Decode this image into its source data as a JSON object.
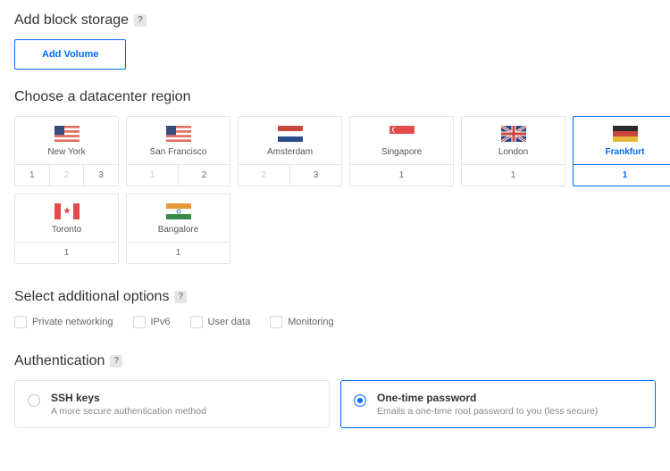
{
  "block_storage": {
    "heading": "Add block storage",
    "add_button": "Add Volume"
  },
  "datacenter": {
    "heading": "Choose a datacenter region",
    "regions": [
      {
        "name": "New York",
        "nums": [
          {
            "n": "1",
            "d": false
          },
          {
            "n": "2",
            "d": true
          },
          {
            "n": "3",
            "d": false
          }
        ]
      },
      {
        "name": "San Francisco",
        "nums": [
          {
            "n": "1",
            "d": true
          },
          {
            "n": "2",
            "d": false
          }
        ]
      },
      {
        "name": "Amsterdam",
        "nums": [
          {
            "n": "2",
            "d": true
          },
          {
            "n": "3",
            "d": false
          }
        ]
      },
      {
        "name": "Singapore",
        "nums": [
          {
            "n": "1",
            "d": false
          }
        ]
      },
      {
        "name": "London",
        "nums": [
          {
            "n": "1",
            "d": false
          }
        ]
      },
      {
        "name": "Frankfurt",
        "nums": [
          {
            "n": "1",
            "d": false,
            "active": true
          }
        ],
        "selected": true
      },
      {
        "name": "Toronto",
        "nums": [
          {
            "n": "1",
            "d": false
          }
        ]
      },
      {
        "name": "Bangalore",
        "nums": [
          {
            "n": "1",
            "d": false
          }
        ]
      }
    ]
  },
  "additional": {
    "heading": "Select additional options",
    "options": [
      {
        "label": "Private networking"
      },
      {
        "label": "IPv6"
      },
      {
        "label": "User data"
      },
      {
        "label": "Monitoring"
      }
    ]
  },
  "auth": {
    "heading": "Authentication",
    "ssh": {
      "title": "SSH keys",
      "desc": "A more secure authentication method"
    },
    "otp": {
      "title": "One-time password",
      "desc": "Emails a one-time root password to you (less secure)"
    }
  }
}
